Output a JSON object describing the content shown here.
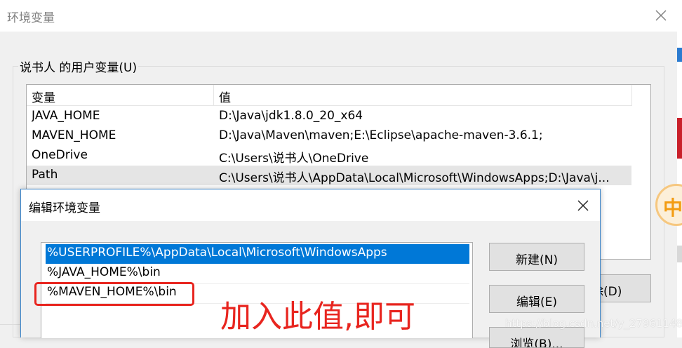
{
  "env_window": {
    "title": "环境变量",
    "user_vars_label": "说书人 的用户变量(U)",
    "table": {
      "columns": [
        "变量",
        "值"
      ],
      "rows": [
        {
          "name": "JAVA_HOME",
          "value": "D:\\Java\\jdk1.8.0_20_x64"
        },
        {
          "name": "MAVEN_HOME",
          "value": "D:\\Java\\Maven\\maven;E:\\Eclipse\\apache-maven-3.6.1;"
        },
        {
          "name": "OneDrive",
          "value": "C:\\Users\\说书人\\OneDrive"
        },
        {
          "name": "Path",
          "value": "C:\\Users\\说书人\\AppData\\Local\\Microsoft\\WindowsApps;D:\\Java\\j..."
        }
      ],
      "selected_row": 3
    },
    "delete_button_partial": "除(D)"
  },
  "edit_dialog": {
    "title": "编辑环境变量",
    "entries": [
      "%USERPROFILE%\\AppData\\Local\\Microsoft\\WindowsApps",
      "%JAVA_HOME%\\bin",
      "%MAVEN_HOME%\\bin"
    ],
    "selected_entry": 0,
    "buttons": {
      "new": "新建(N)",
      "edit": "编辑(E)",
      "browse_partial": "浏览(B)..."
    }
  },
  "annotation": {
    "text": "加入此值,即可",
    "color": "#e8251f"
  },
  "side_badge": "中",
  "watermark": "https://blog.csdn.net/y_279611480",
  "colors": {
    "selection_blue": "#0078d7",
    "dialog_border": "#3a84c9"
  }
}
